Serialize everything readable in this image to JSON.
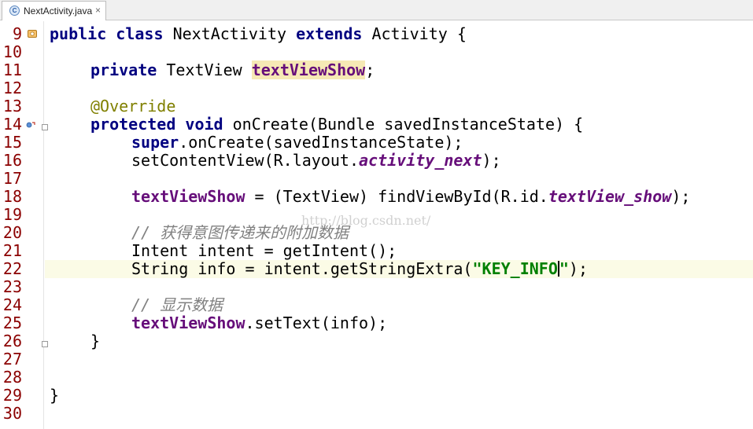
{
  "tab": {
    "icon_letter": "C",
    "title": "NextActivity.java",
    "close_glyph": "×"
  },
  "line_numbers": [
    "9",
    "10",
    "11",
    "12",
    "13",
    "14",
    "15",
    "16",
    "17",
    "18",
    "19",
    "20",
    "21",
    "22",
    "23",
    "24",
    "25",
    "26",
    "27",
    "28",
    "29",
    "30"
  ],
  "code": {
    "l9": {
      "kw1": "public",
      "kw2": "class",
      "name": "NextActivity",
      "kw3": "extends",
      "rest": "Activity {"
    },
    "l11": {
      "kw": "private",
      "type": "TextView",
      "field": "textViewShow",
      "end": ";"
    },
    "l13": {
      "anno": "@Override"
    },
    "l14": {
      "kw1": "protected",
      "kw2": "void",
      "rest": "onCreate(Bundle savedInstanceState) {"
    },
    "l15": {
      "kw": "super",
      "rest": ".onCreate(savedInstanceState);"
    },
    "l16": {
      "pre": "setContentView(R.layout.",
      "rconst": "activity_next",
      "end": ");"
    },
    "l18": {
      "field": "textViewShow",
      "mid": " = (TextView) findViewById(R.id.",
      "rconst": "textView_show",
      "end": ");"
    },
    "l20": {
      "comment": "// 获得意图传递来的附加数据"
    },
    "l21": {
      "text": "Intent intent = getIntent();"
    },
    "l22": {
      "pre": "String info = intent.getStringExtra(",
      "str": "\"KEY_INFO",
      "str_end": "\"",
      "end": ");"
    },
    "l24": {
      "comment": "// 显示数据"
    },
    "l25": {
      "field": "textViewShow",
      "rest": ".setText(info);"
    },
    "l26": {
      "text": "}"
    },
    "l29": {
      "text": "}"
    }
  },
  "watermark": "http://blog.csdn.net/",
  "colors": {
    "keyword": "#000080",
    "field": "#660e7a",
    "annotation": "#808000",
    "comment": "#808080",
    "string": "#008000",
    "line_number": "#8b0000",
    "current_line": "#fbfbe6"
  },
  "icons": {
    "line9": "class-override-icon",
    "line14": "override-method-icon"
  }
}
